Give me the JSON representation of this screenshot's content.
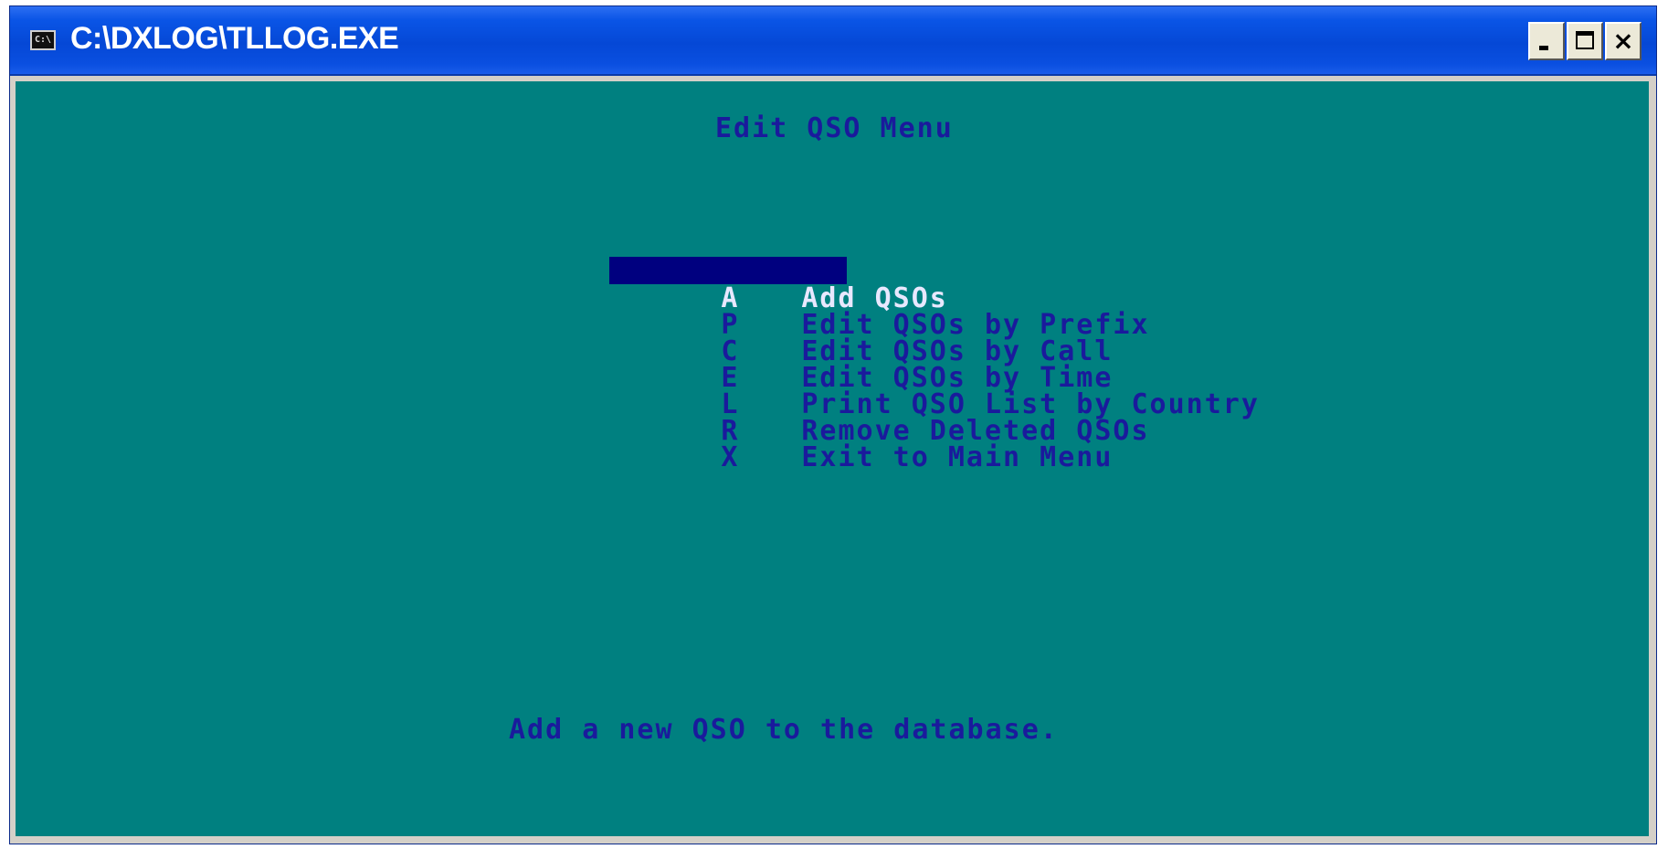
{
  "window": {
    "title": "C:\\DXLOG\\TLLOG.EXE",
    "icon": "console-icon",
    "controls": {
      "minimize": "minimize-icon",
      "maximize": "maximize-icon",
      "close": "×"
    }
  },
  "console": {
    "heading": "Edit QSO Menu",
    "menu": [
      {
        "key": "A",
        "label": "Add QSOs",
        "selected": true
      },
      {
        "key": "P",
        "label": "Edit QSOs by Prefix",
        "selected": false
      },
      {
        "key": "C",
        "label": "Edit QSOs by Call",
        "selected": false
      },
      {
        "key": "E",
        "label": "Edit QSOs by Time",
        "selected": false
      },
      {
        "key": "L",
        "label": "Print QSO List by Country",
        "selected": false
      },
      {
        "key": "R",
        "label": "Remove Deleted QSOs",
        "selected": false
      },
      {
        "key": "X",
        "label": "Exit to Main Menu",
        "selected": false
      }
    ],
    "status": "Add a new QSO to the database."
  },
  "colors": {
    "console_bg": "#008080",
    "console_fg": "#1a1a9c",
    "highlight_bg": "#00007f",
    "highlight_fg": "#e8e8ff",
    "titlebar": "#0548d6"
  }
}
